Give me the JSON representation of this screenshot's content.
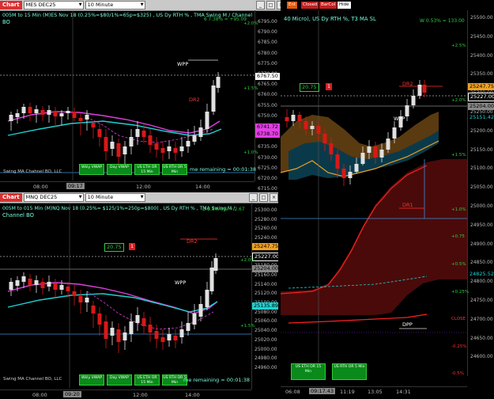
{
  "colors": {
    "up": "#e0e0e0",
    "down": "#d81818",
    "magenta": "#e040e0",
    "cyan": "#20d0d0",
    "green": "#2ecc40",
    "red": "#ff3030"
  },
  "top": {
    "tab": "Chart",
    "symbol": "MES DEC25",
    "interval": "10 Minute",
    "header": "005M to 15 Min (M)ES Nov 18 (0.25%=$80/1%=65p=$325) , US Dy RTH % , TMA Swing M / Channel",
    "header2": "BO",
    "topright": "6 7.38% = +95.09",
    "axis": [
      "6795.00",
      "6790.00",
      "6785.00",
      "6780.00",
      "6775.00",
      "6770.00",
      "6765.00",
      "6760.00",
      "6755.00",
      "6750.00",
      "6745.00",
      "6740.00",
      "6735.00",
      "6730.00",
      "6725.00",
      "6720.00",
      "6715.00"
    ],
    "price_boxes": {
      "p1": "6767.50",
      "p2": "6741.72",
      "p3": "6738.70"
    },
    "pcts": {
      "a": "+2.0%",
      "b": "+1.5%",
      "c": "+1.0%"
    },
    "labels": {
      "wpp": "WPP",
      "dr2": "DR2"
    },
    "footer": "me remaining = 00:01:38",
    "brand": "Swing MA Chahnel BO, LLC",
    "buttons": [
      "Wkly VWAP",
      "Day VWAP",
      "US ETH OR 15 Min",
      "US RTH OR 5 Min"
    ],
    "times": [
      "08:00",
      "09:17",
      "12:00",
      "14:00"
    ]
  },
  "mid": {
    "tab": "Chart",
    "symbol": "MNQ DEC25",
    "interval": "10 Minute",
    "header": "005M to 015 Min (M)NQ Nov 18 (0.25%= $125/1%=250p=$800) , US Dy RTH % , TMA Swing M /",
    "header2": "Channel BO",
    "topright": "D 2.8% 8% = 2.67",
    "axis": [
      "25300.00",
      "25280.00",
      "25260.00",
      "25240.00",
      "25220.00",
      "25200.00",
      "25180.00",
      "25160.00",
      "25140.00",
      "25120.00",
      "25100.00",
      "25080.00",
      "25060.00",
      "25040.00",
      "25020.00",
      "25000.00",
      "24980.00",
      "24960.00"
    ],
    "price_boxes": {
      "p1": "25247.75",
      "p2": "25227.00",
      "p3": "25204.00",
      "p4": "25135.89"
    },
    "pcts": {
      "a": "+2.0%",
      "b": "+1.5%"
    },
    "boxlabel": "20.75",
    "redsq": "1",
    "labels": {
      "wpp": "WPP",
      "dr2": "DR2"
    },
    "footer": "me remaining = 00:01:38",
    "brand": "Swing MA Channel BO, LLC",
    "buttons": [
      "Wkly VWAP",
      "Day VWAP",
      "US ETH OR 15 Min",
      "US RTH OR 5 Min"
    ],
    "times": [
      "08:00",
      "09:20",
      "12:00",
      "14:00"
    ]
  },
  "right": {
    "buttons": [
      "Ent",
      "Closed",
      "BarCol",
      "Hide"
    ],
    "header": "40 Micro), US Dy RTH %, T3 MA SL",
    "topright": "W 0.53% = 133.00",
    "axis": [
      "25500.00",
      "25450.00",
      "25400.00",
      "25350.00",
      "25300.00",
      "25250.00",
      "25200.00",
      "25150.00",
      "25100.00",
      "25050.00",
      "25000.00",
      "24950.00",
      "24900.00",
      "24850.00",
      "24800.00",
      "24750.00",
      "24700.00",
      "24650.00",
      "24600.00"
    ],
    "price_boxes": {
      "p1": "25247.75",
      "p2": "25227.00",
      "p3": "25204.00",
      "p4": "25151.42",
      "p5": "24825.52"
    },
    "pcts": {
      "a": "+2.5%",
      "b": "+2.0%",
      "c": "+1.5%",
      "d": "+1.0%",
      "e": "+0.75",
      "f": "+0.5%",
      "g": "+0.25%",
      "h": "CLOSE",
      "i": "-0.25%",
      "j": "-0.5%"
    },
    "boxlabel": "20.75",
    "redsq": "1",
    "labels": {
      "wpp": "WPP",
      "dr2": "DR2",
      "dr1": "DR1",
      "dpp": "DPP"
    },
    "obtns": [
      "US ETH OR 15 Min",
      "US RTH OR 5 Min"
    ],
    "times": [
      "06:08",
      "09:17.43",
      "11:19",
      "13:05",
      "14:31"
    ]
  }
}
